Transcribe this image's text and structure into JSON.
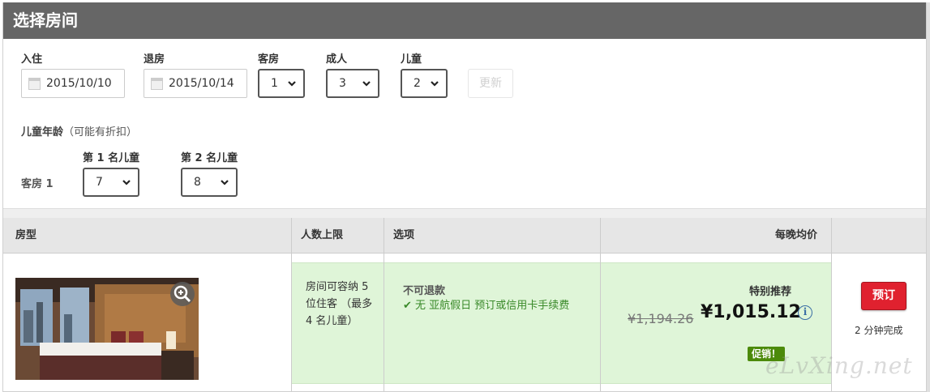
{
  "header": {
    "title": "选择房间"
  },
  "search": {
    "checkin_label": "入住",
    "checkin_value": "2015/10/10",
    "checkout_label": "退房",
    "checkout_value": "2015/10/14",
    "rooms_label": "客房",
    "rooms_value": "1",
    "adults_label": "成人",
    "adults_value": "3",
    "children_label": "儿童",
    "children_value": "2",
    "update_label": "更新"
  },
  "child_ages": {
    "title": "儿童年龄",
    "note": "（可能有折扣）",
    "room_label": "客房 1",
    "child1_label": "第 1 名儿童",
    "child1_value": "7",
    "child2_label": "第 2 名儿童",
    "child2_value": "8"
  },
  "table": {
    "headers": [
      "房型",
      "人数上限",
      "选项",
      "每晚均价"
    ],
    "row": {
      "capacity": "房间可容纳 5 位住客 （最多 4 名儿童）",
      "refund": "不可退款",
      "option": "无 亚航假日 预订或信用卡手续费",
      "special": "特别推荐",
      "old_price": "¥1,194.26",
      "price": "¥1,015.12",
      "promo": "促销！",
      "book_label": "预订",
      "done_text": "2 分钟完成"
    }
  },
  "watermark": "eLvXing.net",
  "colors": {
    "header_bg": "#666666",
    "row_bg": "#dff5d8",
    "book_red": "#e0212f",
    "promo_green": "#4c8a0a"
  }
}
